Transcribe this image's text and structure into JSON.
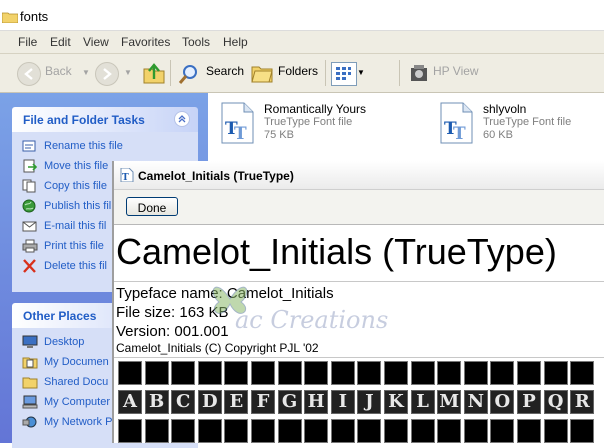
{
  "explorer": {
    "window_title": "fonts",
    "menu": [
      "File",
      "Edit",
      "View",
      "Favorites",
      "Tools",
      "Help"
    ],
    "toolbar": {
      "back": "Back",
      "search": "Search",
      "folders": "Folders",
      "hp_view": "HP View"
    },
    "task_pane": {
      "file_tasks": {
        "title": "File and Folder Tasks",
        "items": [
          {
            "label": "Rename this file",
            "icon": "rename-icon"
          },
          {
            "label": "Move this file",
            "icon": "move-icon"
          },
          {
            "label": "Copy this file",
            "icon": "copy-icon"
          },
          {
            "label": "Publish this fil",
            "icon": "publish-icon"
          },
          {
            "label": "E-mail this fil",
            "icon": "email-icon"
          },
          {
            "label": "Print this file",
            "icon": "print-icon"
          },
          {
            "label": "Delete this fil",
            "icon": "delete-icon"
          }
        ]
      },
      "other_places": {
        "title": "Other Places",
        "items": [
          {
            "label": "Desktop",
            "icon": "desktop-icon"
          },
          {
            "label": "My Documen",
            "icon": "my-documents-icon"
          },
          {
            "label": "Shared Docu",
            "icon": "shared-documents-icon"
          },
          {
            "label": "My Computer",
            "icon": "my-computer-icon"
          },
          {
            "label": "My Network P",
            "icon": "my-network-icon"
          }
        ]
      }
    },
    "files": [
      {
        "name": "Romantically Yours",
        "type": "TrueType Font file",
        "size": "75 KB"
      },
      {
        "name": "shlyvoln",
        "type": "TrueType Font file",
        "size": "60 KB"
      }
    ]
  },
  "viewer": {
    "title": "Camelot_Initials (TrueType)",
    "done_label": "Done",
    "heading": "Camelot_Initials (TrueType)",
    "typeface": "Typeface name: Camelot_Initials",
    "filesize": "File size: 163 KB",
    "version": "Version: 001.001",
    "copyright": "Camelot_Initials (C) Copyright PJL '02",
    "sample_letters": [
      "A",
      "B",
      "C",
      "D",
      "E",
      "F",
      "G",
      "H",
      "I",
      "J",
      "K",
      "L",
      "M",
      "N",
      "O",
      "P",
      "Q",
      "R"
    ]
  },
  "watermark": {
    "text": "ac Creations"
  },
  "colors": {
    "link": "#215dc6",
    "pane_bg": "#6f8be0",
    "panel_body": "#d6dff7"
  }
}
